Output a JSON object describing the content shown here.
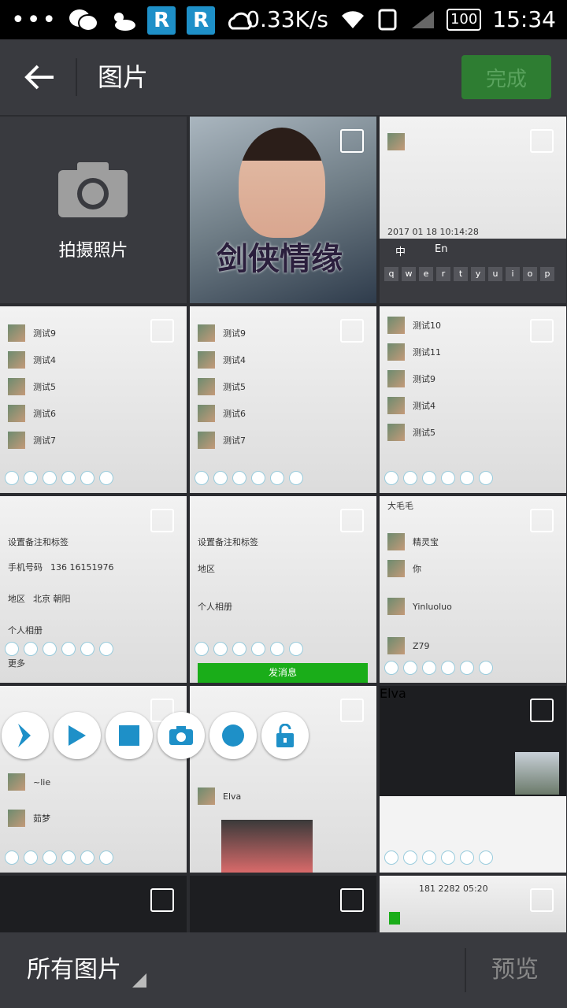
{
  "status_bar": {
    "net_speed": "0.33K/s",
    "battery": "100",
    "time": "15:34",
    "app_icon_letter": "R"
  },
  "header": {
    "title": "图片",
    "done_label": "完成"
  },
  "grid": {
    "camera_label": "拍摄照片",
    "poster_title": "剑侠情缘",
    "chat_cell": {
      "timestamp": "2017 01 18 10:14:28",
      "ime": "中",
      "ime_en": "En",
      "keys": [
        "q",
        "w",
        "e",
        "r",
        "t",
        "y",
        "u",
        "i",
        "o",
        "p"
      ]
    },
    "test_rows": [
      "测试10",
      "测试11",
      "测试9",
      "测试4",
      "测试5",
      "测试6",
      "测试7"
    ],
    "settings_rows": [
      "设置备注和标签",
      "手机号码",
      "地区",
      "个人相册",
      "更多"
    ],
    "phone": "136 16151976",
    "region": "北京 朝阳",
    "contact_names": [
      "大毛毛",
      "精灵宝",
      "你",
      "Yinluoluo",
      "Z79",
      "~lie",
      "茹梦",
      "Elva"
    ],
    "send_label": "发消息",
    "timestamp2": "181 2282 05:20"
  },
  "footer": {
    "album_label": "所有图片",
    "preview_label": "预览"
  },
  "colors": {
    "bar": "#393a3f",
    "done_bg": "#2e7d32",
    "accent_blue": "#1e90c8"
  }
}
